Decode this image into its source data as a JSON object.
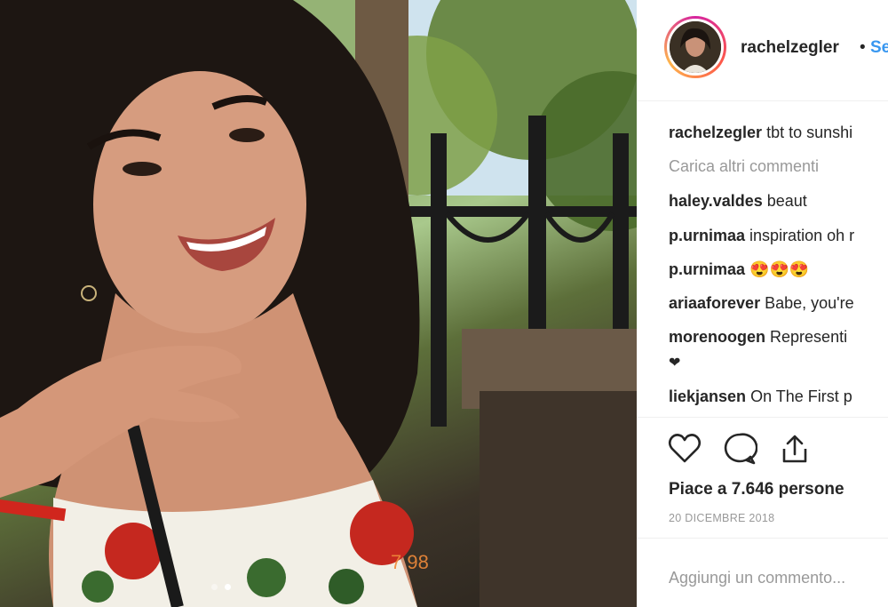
{
  "post": {
    "username": "rachelzegler",
    "separator": "•",
    "follow_label": "Se"
  },
  "comments": [
    {
      "user": "rachelzegler",
      "text": "tbt to sunshi"
    },
    {
      "user": "",
      "text": "Carica altri commenti",
      "type": "load-more"
    },
    {
      "user": "haley.valdes",
      "text": "beaut"
    },
    {
      "user": "p.urnimaa",
      "text": "inspiration oh r"
    },
    {
      "user": "p.urnimaa",
      "text": "😍😍😍"
    },
    {
      "user": "ariaaforever",
      "text": "Babe, you're"
    },
    {
      "user": "morenoogen",
      "text": "Representi"
    },
    {
      "user": "",
      "text": "❤"
    },
    {
      "user": "liekjansen",
      "text": "On The First p"
    }
  ],
  "actions": {
    "like_icon": "heart-icon",
    "comment_icon": "comment-icon",
    "share_icon": "share-icon",
    "likes_text": "Piace a 7.646 persone",
    "date": "20 DICEMBRE 2018"
  },
  "add_comment": {
    "placeholder": "Aggiungi un commento..."
  },
  "carousel": {
    "count": 2,
    "active_index": 1
  },
  "photo": {
    "overlay_text": "7  98"
  }
}
